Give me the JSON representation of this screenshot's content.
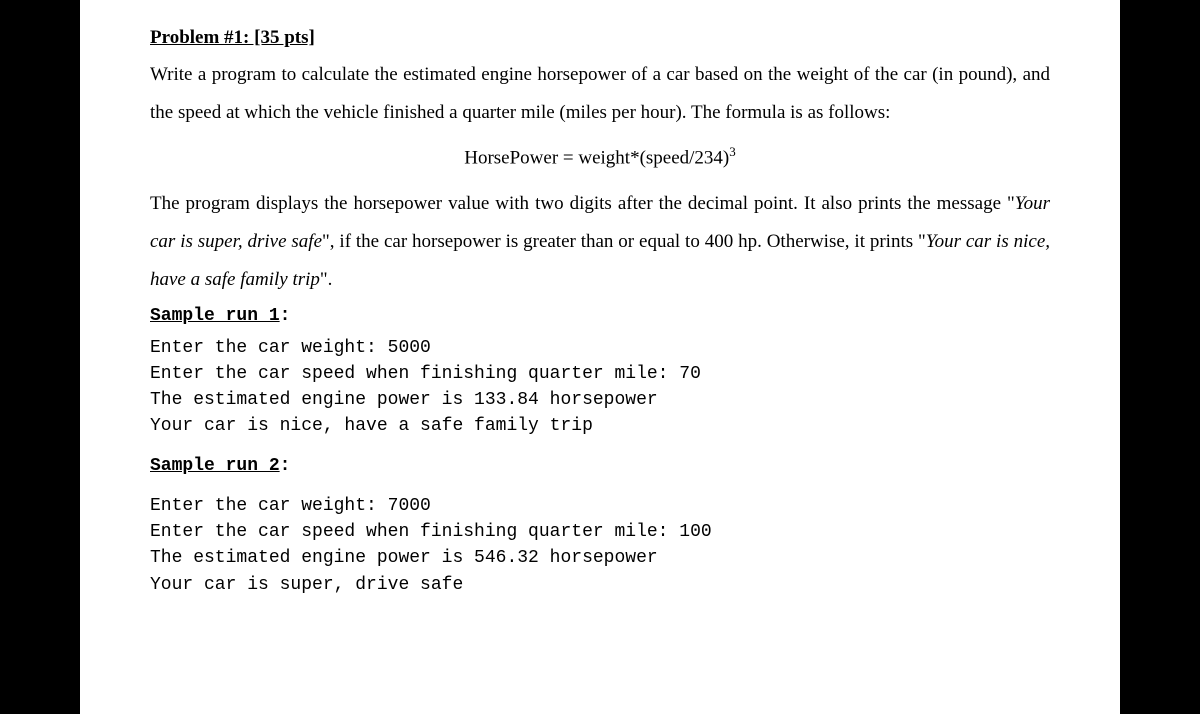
{
  "title": "Problem #1: [35 pts]",
  "description_part1": "Write a program to calculate the estimated engine horsepower of a car based on the weight of the car (in pound), and the speed at which the vehicle finished a quarter mile (miles per hour). The formula is as follows:",
  "formula_text": "HorsePower = weight*(speed/234)",
  "formula_exponent": "3",
  "description_part2a": "The program displays the horsepower value with two digits after the decimal point. It also prints the message \"",
  "italic1": "Your car is super, drive safe",
  "description_part2b": "\", if the car horsepower is greater than or equal to 400 hp. Otherwise, it prints \"",
  "italic2": "Your car is nice, have a safe family trip",
  "description_part2c": "\".",
  "sample1_label": "Sample run 1",
  "sample1_colon": ":",
  "sample1_code": "Enter the car weight: 5000\nEnter the car speed when finishing quarter mile: 70\nThe estimated engine power is 133.84 horsepower\nYour car is nice, have a safe family trip",
  "sample2_label": "Sample run 2",
  "sample2_colon": ":",
  "sample2_code": "Enter the car weight: 7000\nEnter the car speed when finishing quarter mile: 100\nThe estimated engine power is 546.32 horsepower\nYour car is super, drive safe"
}
